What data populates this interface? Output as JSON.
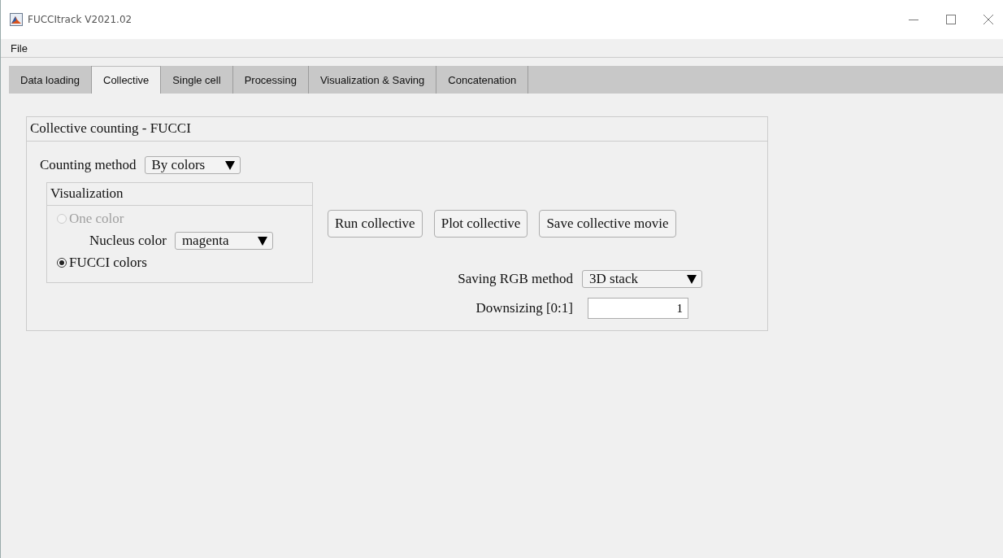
{
  "window": {
    "title": "FUCCItrack V2021.02"
  },
  "menu": [
    "File"
  ],
  "tabs": [
    {
      "label": "Data loading",
      "selected": false
    },
    {
      "label": "Collective",
      "selected": true
    },
    {
      "label": "Single cell",
      "selected": false
    },
    {
      "label": "Processing",
      "selected": false
    },
    {
      "label": "Visualization & Saving",
      "selected": false
    },
    {
      "label": "Concatenation",
      "selected": false
    }
  ],
  "panel": {
    "title": "Collective counting - FUCCI",
    "counting_method": {
      "label": "Counting method",
      "value": "By colors"
    },
    "visualization": {
      "title": "Visualization",
      "options": [
        {
          "label": "One color",
          "selected": false,
          "disabled": true
        },
        {
          "label": "FUCCI colors",
          "selected": true,
          "disabled": false
        }
      ],
      "nucleus_color": {
        "label": "Nucleus color",
        "value": "magenta"
      }
    },
    "buttons": [
      "Run collective",
      "Plot collective",
      "Save collective movie"
    ],
    "saving_rgb_method": {
      "label": "Saving RGB method",
      "value": "3D stack"
    },
    "downsizing": {
      "label": "Downsizing [0:1]",
      "value": "1"
    }
  }
}
